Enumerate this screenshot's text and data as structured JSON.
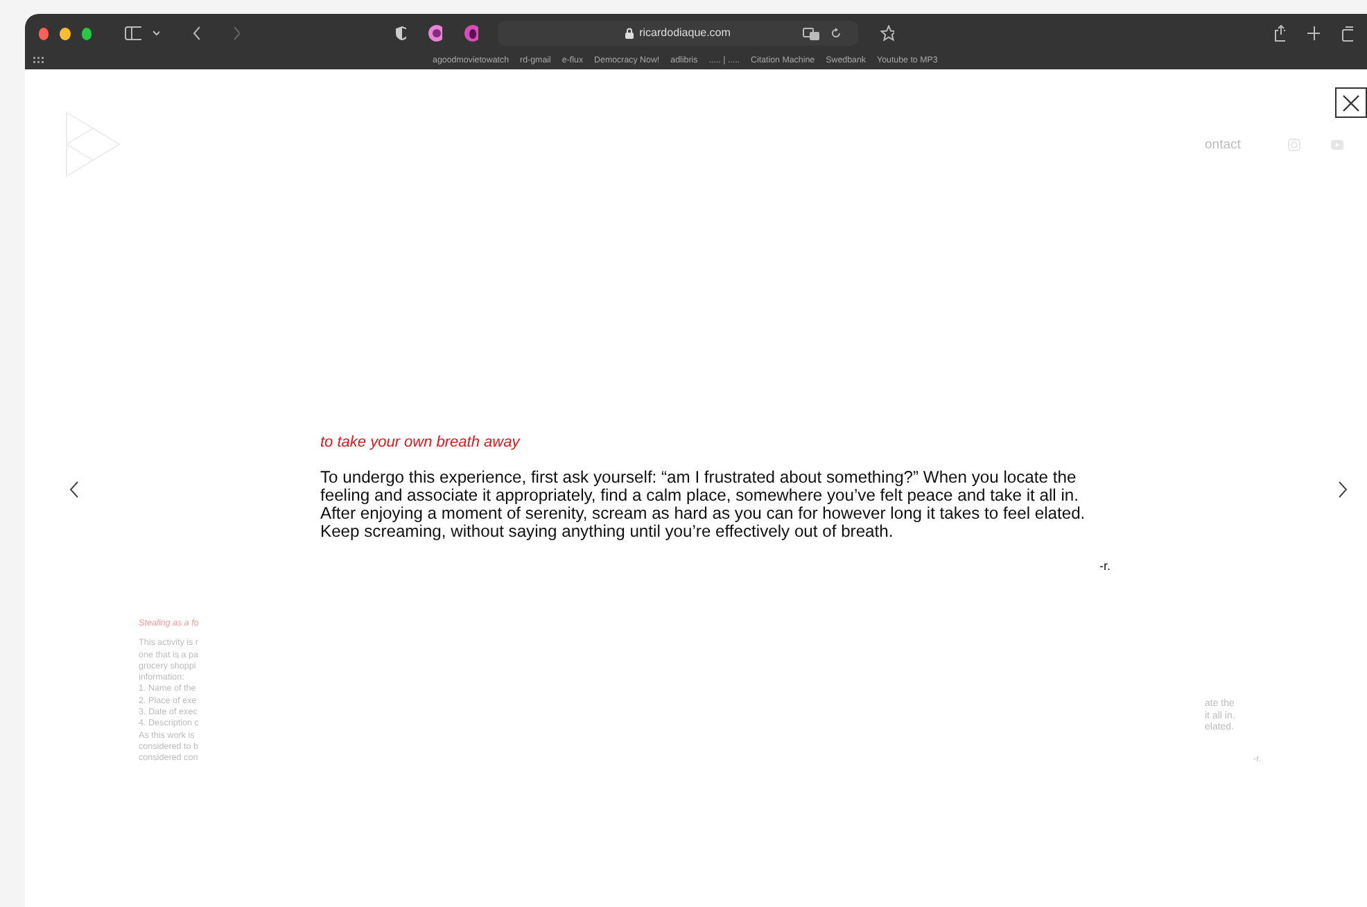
{
  "browser": {
    "address": "ricardodiaque.com",
    "bookmarks": [
      "agoodmovietowatch",
      "rd-gmail",
      "e-flux",
      "Democracy Now!",
      "adlibris",
      "..... | .....",
      "Citation Machine",
      "Swedbank",
      "Youtube to MP3"
    ]
  },
  "background_page": {
    "nav_link": "ontact",
    "left_title": "Stealing as a fo",
    "left_lines": [
      "This activity is r",
      "one that is a pa",
      "grocery shoppi",
      "information:",
      "1. Name of the",
      "2. Place of exe",
      "3. Date of exec",
      "4. Description c",
      "As this work is",
      "considered to b",
      "considered con"
    ],
    "right_lines": [
      "ate the",
      "it all in.",
      "elated."
    ],
    "right_signature": "-r."
  },
  "lightbox": {
    "title": "to take your own breath away",
    "body": "To undergo this experience, first ask yourself: “am I frustrated about something?” When you locate the feeling and associate it appropriately, find a calm place, somewhere you’ve felt peace and take it all in. After enjoying a moment of serenity, scream as hard as you can for however long it takes to feel elated. Keep screaming, without saying anything until you’re effectively out of breath.",
    "signature": "-r."
  }
}
